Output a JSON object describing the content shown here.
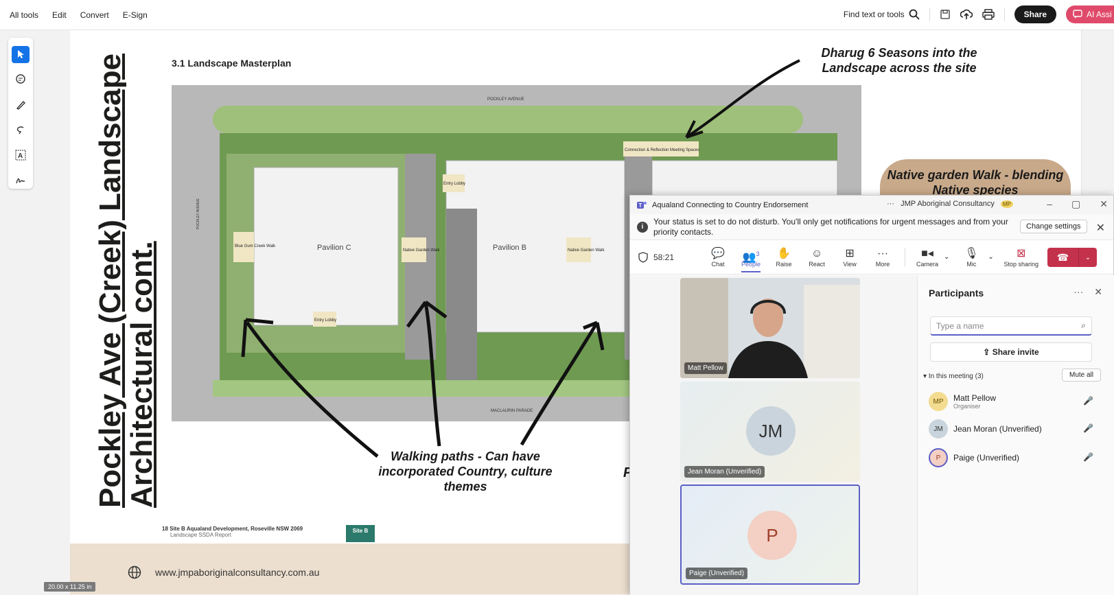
{
  "menu": [
    "All tools",
    "Edit",
    "Convert",
    "E-Sign"
  ],
  "toolbar": {
    "find_label": "Find text or tools",
    "share_label": "Share",
    "ai_label": "AI Assi"
  },
  "doc": {
    "vertical_title_line1": "Pockley Ave (Creek) Landscape",
    "vertical_title_line2": "Architectural cont.",
    "section_heading": "3.1   Landscape Masterplan",
    "plan_labels": {
      "pockley_avenue": "POCKLEY AVENUE",
      "pockley_avenue_side": "POCKLEY AVENUE",
      "maclaurin": "MACLAURIN PARADE",
      "pavilion_c": "Pavilion C",
      "pavilion_b": "Pavilion B",
      "entry_lobby_top": "Entry Lobby",
      "entry_lobby_bottom": "Entry Lobby",
      "blue_gum": "Blue Gum Creek Walk",
      "native_garden_1": "Native Garden Walk",
      "native_garden_2": "Native Garden Walk",
      "connection": "Connection & Reflection Meeting Spaces"
    },
    "annotation_top": "Dharug 6 Seasons into the Landscape across the site",
    "annotation_bottom": "Walking paths - Can have incorporated Country, culture themes",
    "bubble_text": "Native garden Walk - blending Native species",
    "footer_site": "18   Site B Aqualand Development, Roseville NSW 2069",
    "footer_report": "Landscape SSDA Report",
    "site_tag": "Site B",
    "footer_url": "www.jmpaboriginalconsultancy.com.au",
    "page_dims": "20.00 x 11.25 in",
    "stray_letter": "P"
  },
  "teams": {
    "window_title": "Aqualand Connecting to Country Endorsement",
    "org_name": "JMP Aboriginal Consultancy",
    "org_badge": "MP",
    "dnd_message": "Your status is set to do not disturb. You'll only get notifications for urgent messages and from your priority contacts.",
    "change_settings": "Change settings",
    "timer": "58:21",
    "buttons": {
      "chat": "Chat",
      "people": "People",
      "people_count": "3",
      "raise": "Raise",
      "react": "React",
      "view": "View",
      "more": "More",
      "camera": "Camera",
      "mic": "Mic",
      "stop_sharing": "Stop sharing"
    },
    "tiles": [
      {
        "name": "Matt Pellow"
      },
      {
        "name": "Jean Moran (Unverified)",
        "initials": "JM"
      },
      {
        "name": "Paige (Unverified)",
        "initials": "P"
      }
    ],
    "participants": {
      "title": "Participants",
      "search_placeholder": "Type a name",
      "share_invite": "Share invite",
      "in_meeting": "In this meeting (3)",
      "mute_all": "Mute all",
      "list": [
        {
          "initials": "MP",
          "name": "Matt Pellow",
          "role": "Organiser"
        },
        {
          "initials": "JM",
          "name": "Jean Moran (Unverified)",
          "role": ""
        },
        {
          "initials": "P",
          "name": "Paige (Unverified)",
          "role": ""
        }
      ]
    }
  },
  "colors": {
    "accent": "#5b5fc7",
    "leave": "#c4314b",
    "acrobat_blue": "#1473e6",
    "footer_band": "#ecdfcf",
    "bubble": "#c8a98a"
  }
}
